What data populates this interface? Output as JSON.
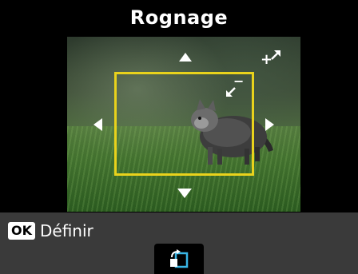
{
  "screen": {
    "title": "Rognage"
  },
  "preview": {
    "icons": {
      "arrow_up": "arrow-up-icon",
      "arrow_down": "arrow-down-icon",
      "arrow_left": "arrow-left-icon",
      "arrow_right": "arrow-right-icon",
      "expand": "expand-icon",
      "shrink": "shrink-icon"
    },
    "expand_symbol": "+",
    "shrink_symbol": "−",
    "crop_frame_color": "#e9d21c"
  },
  "footer": {
    "ok_badge": "OK",
    "ok_label": "Définir",
    "rotate_icon": "rotate-icon"
  }
}
